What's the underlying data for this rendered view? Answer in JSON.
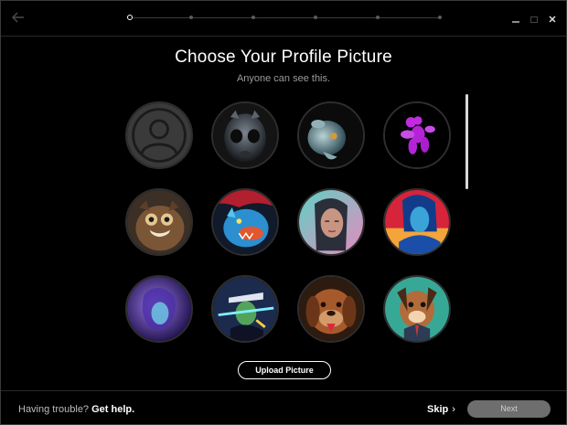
{
  "header": {
    "title": "Choose Your Profile Picture",
    "subtitle": "Anyone can see this."
  },
  "stepper": {
    "total_steps": 6,
    "current_step": 1
  },
  "avatars": [
    {
      "name": "default-silhouette",
      "selected": false
    },
    {
      "name": "grey-alien"
    },
    {
      "name": "blue-creature"
    },
    {
      "name": "pink-balloon-dog"
    },
    {
      "name": "owl-creature"
    },
    {
      "name": "blue-dragon"
    },
    {
      "name": "woman-portrait"
    },
    {
      "name": "blue-woman"
    },
    {
      "name": "purple-figure"
    },
    {
      "name": "neon-character"
    },
    {
      "name": "brown-dog"
    },
    {
      "name": "cartoon-dog"
    }
  ],
  "actions": {
    "upload_label": "Upload Picture",
    "help_prefix": "Having trouble?",
    "help_link": "Get help.",
    "skip_label": "Skip",
    "skip_chevron": "›",
    "next_label": "Next"
  },
  "colors": {
    "background": "#000000",
    "next_disabled": "#6e6e6e",
    "accent_pink": "#c02be0"
  }
}
